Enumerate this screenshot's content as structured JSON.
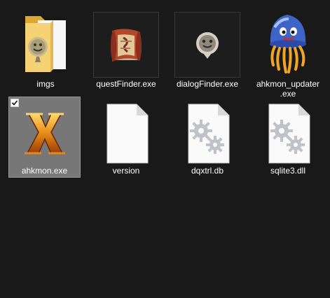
{
  "window": {
    "background": "#191919",
    "selected_background": "#777777"
  },
  "files": [
    {
      "name": "imgs",
      "icon": "folder-icon"
    },
    {
      "name": "questFinder.exe",
      "icon": "scroll-icon"
    },
    {
      "name": "dialogFinder.exe",
      "icon": "speech-bubble-icon"
    },
    {
      "name": "ahkmon_updater\n.exe",
      "icon": "slime-jellyfish-icon"
    },
    {
      "name": "ahkmon.exe",
      "icon": "x-logo-icon",
      "selected": true
    },
    {
      "name": "version",
      "icon": "blank-file-icon"
    },
    {
      "name": "dqxtrl.db",
      "icon": "settings-file-icon"
    },
    {
      "name": "sqlite3.dll",
      "icon": "settings-file-icon"
    }
  ]
}
